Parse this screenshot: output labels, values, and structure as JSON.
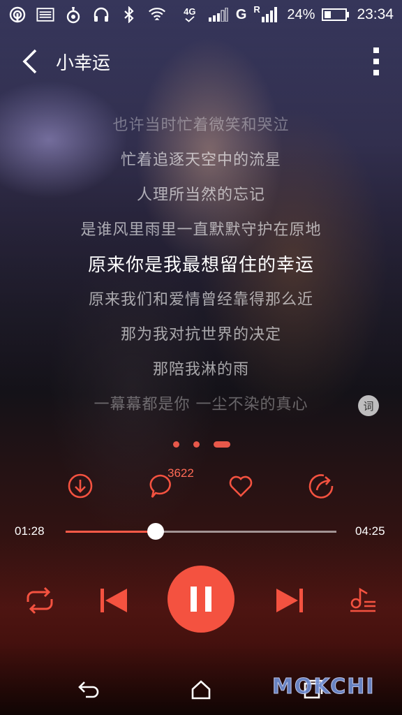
{
  "status_bar": {
    "network": "4G",
    "carrier_g": "G",
    "carrier_r": "R",
    "battery": "24%",
    "time": "23:34"
  },
  "header": {
    "title": "小幸运"
  },
  "lyrics": [
    "也许当时忙着微笑和哭泣",
    "忙着追逐天空中的流星",
    "人理所当然的忘记",
    "是谁风里雨里一直默默守护在原地",
    "原来你是我最想留住的幸运",
    "原来我们和爱情曾经靠得那么近",
    "那为我对抗世界的决定",
    "那陪我淋的雨",
    "一幕幕都是你 一尘不染的真心"
  ],
  "lyric_badge": "词",
  "actions": {
    "comment_count": "3622"
  },
  "progress": {
    "elapsed": "01:28",
    "total": "04:25",
    "fraction": 0.332
  },
  "colors": {
    "accent": "#f45240"
  },
  "watermark": "MOKCHI"
}
